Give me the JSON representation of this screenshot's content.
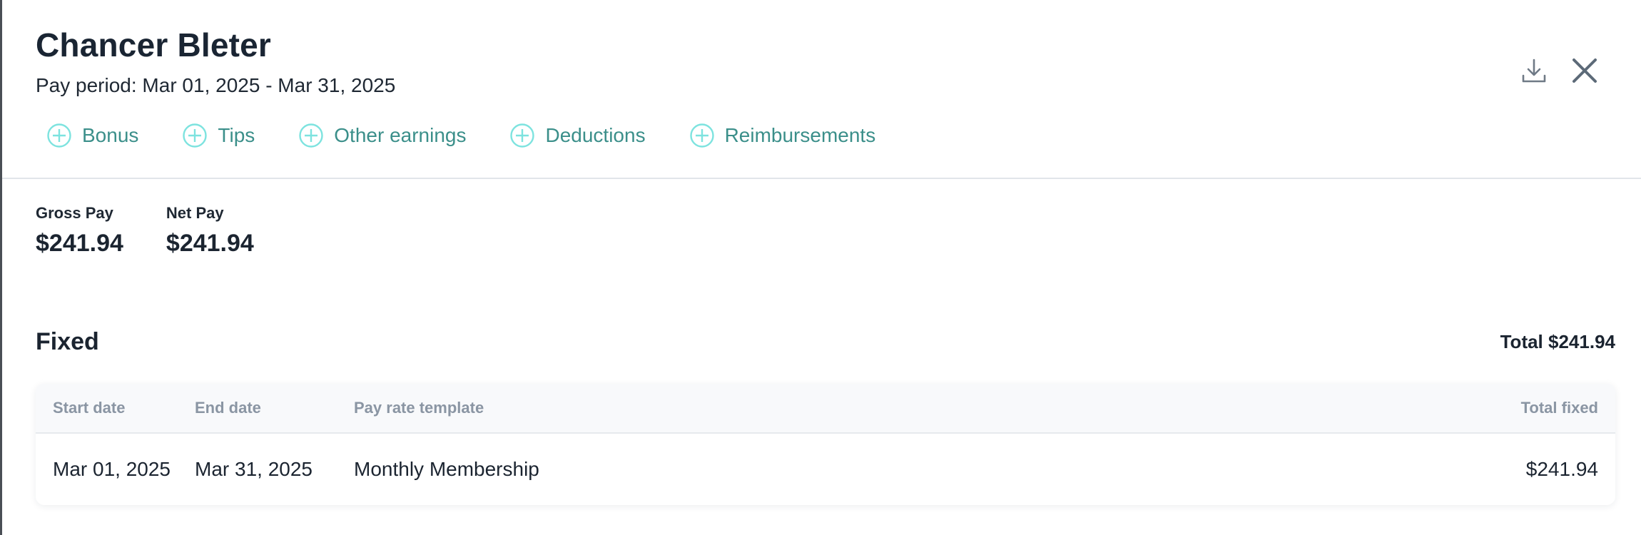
{
  "employee": {
    "name": "Chancer Bleter",
    "pay_period": "Pay period: Mar 01, 2025 - Mar 31, 2025"
  },
  "toolbar": {
    "download_icon": "download-icon",
    "close_icon": "close-icon"
  },
  "actions": [
    {
      "label": "Bonus",
      "icon": "plus-circle-icon"
    },
    {
      "label": "Tips",
      "icon": "plus-circle-icon"
    },
    {
      "label": "Other earnings",
      "icon": "plus-circle-icon"
    },
    {
      "label": "Deductions",
      "icon": "plus-circle-icon"
    },
    {
      "label": "Reimbursements",
      "icon": "plus-circle-icon"
    }
  ],
  "summary": {
    "gross_label": "Gross Pay",
    "gross_value": "$241.94",
    "net_label": "Net Pay",
    "net_value": "$241.94"
  },
  "fixed": {
    "title": "Fixed",
    "total": "Total $241.94",
    "columns": [
      "Start date",
      "End date",
      "Pay rate template",
      "Total fixed"
    ],
    "rows": [
      {
        "start_date": "Mar 01, 2025",
        "end_date": "Mar 31, 2025",
        "template": "Monthly Membership",
        "total_fixed": "$241.94"
      }
    ]
  },
  "colors": {
    "accent_text": "#3b8f8a",
    "accent_icon": "#7de3df",
    "heading": "#1a2533",
    "muted": "#8a95a3"
  }
}
